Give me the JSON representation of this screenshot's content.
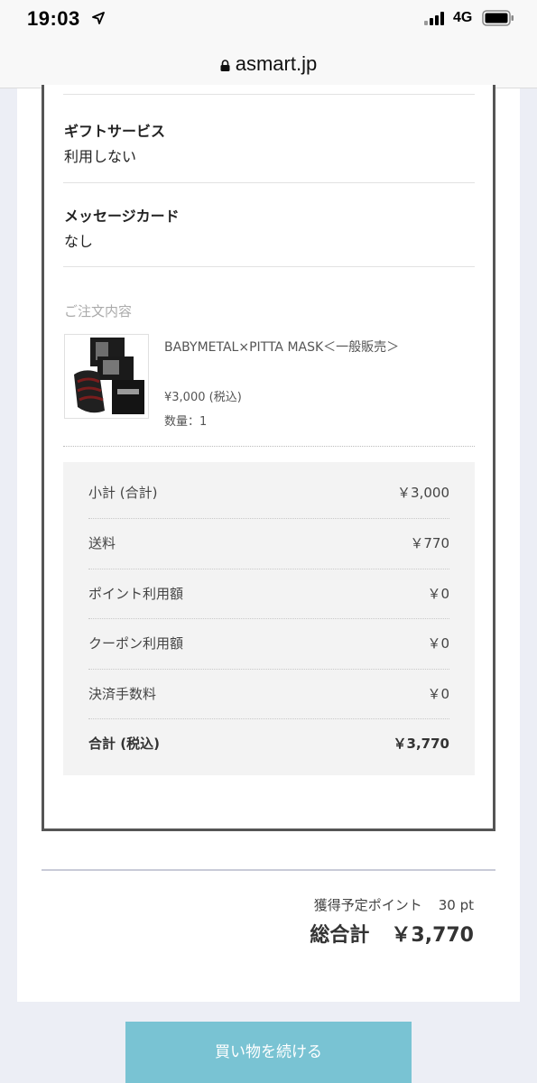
{
  "status_bar": {
    "time": "19:03",
    "network": "4G",
    "icons": [
      "location-arrow-icon",
      "signal-bars-icon",
      "battery-icon"
    ]
  },
  "browser": {
    "url": "asmart.jp",
    "lock_icon": "lock-icon"
  },
  "order": {
    "fields": [
      {
        "label": "ギフトサービス",
        "value": "利用しない"
      },
      {
        "label": "メッセージカード",
        "value": "なし"
      }
    ],
    "section_title": "ご注文内容",
    "item": {
      "name": "BABYMETAL×PITTA MASK＜一般販売＞",
      "price": "¥3,000 (税込)",
      "quantity": "数量：1"
    },
    "summary": [
      {
        "label": "小計 (合計)",
        "value": "￥3,000"
      },
      {
        "label": "送料",
        "value": "￥770"
      },
      {
        "label": "ポイント利用額",
        "value": "￥0"
      },
      {
        "label": "クーポン利用額",
        "value": "￥0"
      },
      {
        "label": "決済手数料",
        "value": "￥0"
      },
      {
        "label": "合計 (税込)",
        "value": "￥3,770"
      }
    ]
  },
  "totals": {
    "points_label": "獲得予定ポイント",
    "points_value": "30 pt",
    "grand_total_label": "総合計",
    "grand_total_value": "￥3,770"
  },
  "continue_button": "買い物を続ける",
  "colors": {
    "page_background": "#eceef5",
    "button": "#79c3d3",
    "summary_background": "#f3f3f3",
    "border": "#555555"
  }
}
